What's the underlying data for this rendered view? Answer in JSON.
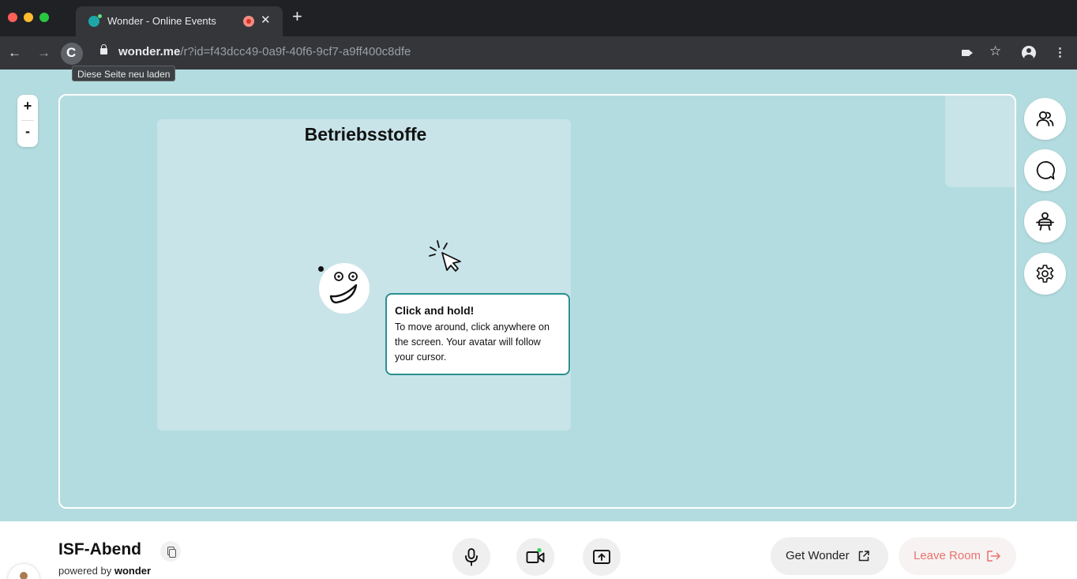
{
  "browser": {
    "tab_title": "Wonder - Online Events",
    "tab_close": "✕",
    "new_tab": "+",
    "nav_back": "←",
    "nav_forward": "→",
    "reload": "C",
    "url_host": "wonder.me",
    "url_path": "/r?id=f43dcc49-0a9f-40f6-9cf7-a9ff400c8dfe",
    "star": "☆",
    "menu": "⋮",
    "tooltip": "Diese Seite neu laden"
  },
  "canvas": {
    "zoom_in": "+",
    "zoom_out": "-",
    "area_title": "Betriebsstoffe",
    "callout": {
      "title": "Click and hold!",
      "text": "To move around, click anywhere on the screen. Your avatar will follow your cursor."
    },
    "side_buttons": [
      "people-icon",
      "chat-icon",
      "broadcast-icon",
      "gear-icon"
    ]
  },
  "footer": {
    "room_name": "ISF-Abend",
    "powered_prefix": "powered by",
    "powered_brand": "wonder",
    "get_wonder": "Get Wonder",
    "leave_room": "Leave Room"
  },
  "colors": {
    "canvas_bg": "#b3dce0",
    "area_bg": "#c8e4e8",
    "callout_border": "#2a8f8f",
    "leave_text": "#e9736d"
  }
}
